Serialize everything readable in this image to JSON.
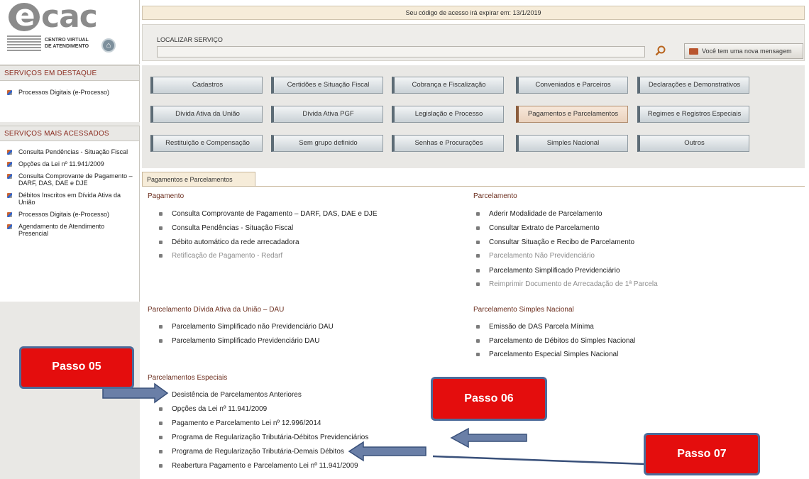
{
  "logo": {
    "mark": "e",
    "word": "cac",
    "subtitle_line1": "CENTRO VIRTUAL",
    "subtitle_line2": "DE ATENDIMENTO"
  },
  "expiry_banner": "Seu código de acesso irá expirar em: 13/1/2019",
  "search": {
    "label": "LOCALIZAR SERVIÇO",
    "value": "",
    "placeholder": ""
  },
  "message_button": "Você tem uma nova mensagem",
  "sidebar": {
    "featured_title": "SERVIÇOS EM DESTAQUE",
    "featured_items": [
      "Processos Digitais (e-Processo)"
    ],
    "most_accessed_title": "SERVIÇOS MAIS ACESSADOS",
    "most_accessed_items": [
      "Consulta Pendências - Situação Fiscal",
      "Opções da Lei nº 11.941/2009",
      "Consulta Comprovante de Pagamento – DARF, DAS, DAE e DJE",
      "Débitos Inscritos em Dívida Ativa da União",
      "Processos Digitais (e-Processo)",
      "Agendamento de Atendimento Presencial"
    ]
  },
  "service_buttons": [
    [
      "Cadastros",
      "Certidões e Situação Fiscal",
      "Cobrança e Fiscalização",
      "Conveniados e Parceiros",
      "Declarações e Demonstrativos"
    ],
    [
      "Dívida Ativa da União",
      "Dívida Ativa PGF",
      "Legislação e Processo",
      "Pagamentos e Parcelamentos",
      "Regimes e Registros Especiais"
    ],
    [
      "Restituição e Compensação",
      "Sem grupo definido",
      "Senhas e Procurações",
      "Simples Nacional",
      "Outros"
    ]
  ],
  "active_service": "Pagamentos e Parcelamentos",
  "tab_label": "Pagamentos e Parcelamentos",
  "groups": {
    "pagamento": {
      "title": "Pagamento",
      "items": [
        "Consulta Comprovante de Pagamento – DARF, DAS, DAE e DJE",
        "Consulta Pendências - Situação Fiscal",
        "Débito automático da rede arrecadadora",
        "Retificação de Pagamento - Redarf"
      ]
    },
    "parcelamento": {
      "title": "Parcelamento",
      "items": [
        "Aderir Modalidade de Parcelamento",
        "Consultar Extrato de Parcelamento",
        "Consultar Situação e Recibo de Parcelamento",
        "Parcelamento Não Previdenciário",
        "Parcelamento Simplificado Previdenciário",
        "Reimprimir Documento de Arrecadação de 1ª Parcela"
      ]
    },
    "dau": {
      "title": "Parcelamento Dívida Ativa da União – DAU",
      "items": [
        "Parcelamento Simplificado não Previdenciário DAU",
        "Parcelamento Simplificado Previdenciário DAU"
      ]
    },
    "simples": {
      "title": "Parcelamento Simples Nacional",
      "items": [
        "Emissão de DAS Parcela Mínima",
        "Parcelamento de Débitos do Simples Nacional",
        "Parcelamento Especial Simples Nacional"
      ]
    },
    "especiais": {
      "title": "Parcelamentos Especiais",
      "items": [
        "Desistência de Parcelamentos Anteriores",
        "Opções da Lei nº 11.941/2009",
        "Pagamento e Parcelamento Lei nº 12.996/2014",
        "Programa de Regularização Tributária-Débitos Previdenciários",
        "Programa de Regularização Tributária-Demais Débitos",
        "Reabertura Pagamento e Parcelamento Lei nº 11.941/2009"
      ]
    }
  },
  "callouts": {
    "step5": "Passo 05",
    "step6": "Passo 06",
    "step7": "Passo 07"
  }
}
